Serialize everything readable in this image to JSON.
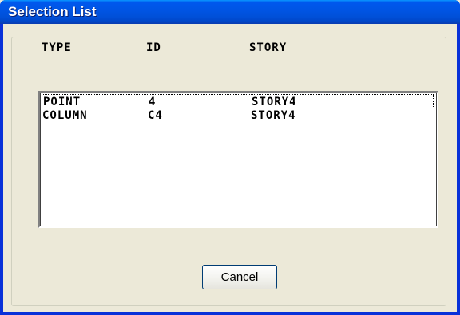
{
  "window": {
    "title": "Selection List"
  },
  "list": {
    "columns": [
      "TYPE",
      "ID",
      "STORY"
    ],
    "rows": [
      {
        "type": "POINT",
        "id": "4",
        "story": "STORY4"
      },
      {
        "type": "COLUMN",
        "id": "C4",
        "story": "STORY4"
      }
    ]
  },
  "buttons": {
    "cancel_label": "Cancel"
  },
  "colors": {
    "titlebar": "#0055e5",
    "window_bg": "#ece9d8",
    "list_bg": "#ffffff"
  }
}
